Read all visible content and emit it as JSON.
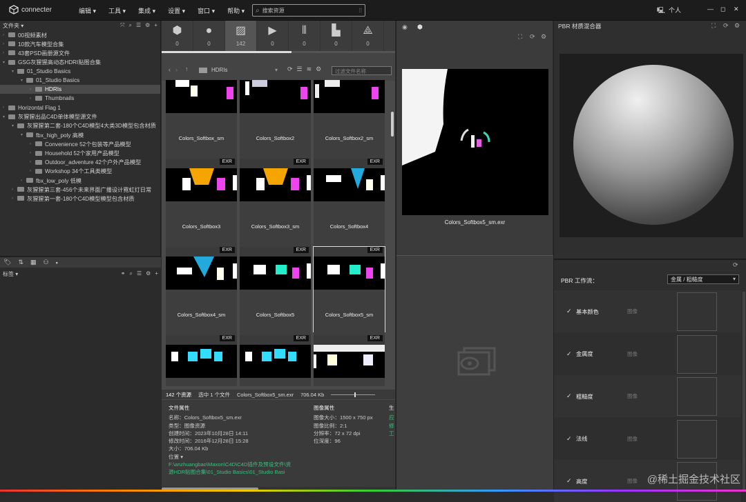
{
  "app": {
    "name": "connecter"
  },
  "menu": [
    "编辑 ▾",
    "工具 ▾",
    "集成 ▾",
    "设置 ▾",
    "窗口 ▾",
    "帮助 ▾"
  ],
  "search": {
    "placeholder": "搜索资源"
  },
  "user": {
    "label": "个人"
  },
  "left": {
    "header": "文件夹 ▾",
    "tree": [
      {
        "indent": 0,
        "label": "00视频素材",
        "arrow": ""
      },
      {
        "indent": 0,
        "label": "10款汽车模型合集",
        "arrow": ""
      },
      {
        "indent": 0,
        "label": "43套PSD画册源文件",
        "arrow": ""
      },
      {
        "indent": 0,
        "label": "GSG灰猩猩高动态HDRI贴图合集",
        "arrow": "▾"
      },
      {
        "indent": 1,
        "label": "01_Studio Basics",
        "arrow": "▾"
      },
      {
        "indent": 2,
        "label": "01_Studio Basics",
        "arrow": "▾"
      },
      {
        "indent": 3,
        "label": "HDRIs",
        "arrow": "",
        "sel": true
      },
      {
        "indent": 3,
        "label": "Thumbnails",
        "arrow": ""
      },
      {
        "indent": 0,
        "label": "Horizontal Flag 1",
        "arrow": ""
      },
      {
        "indent": 0,
        "label": "灰猩猩出品C4D单体模型源文件",
        "arrow": "▾"
      },
      {
        "indent": 1,
        "label": "灰猩猩第二套-180个C4D模型4大类3D模型包含材质",
        "arrow": "▾"
      },
      {
        "indent": 2,
        "label": "fbx_high_poly 高模",
        "arrow": "▾"
      },
      {
        "indent": 3,
        "label": "Convenience 52个包装等产品模型",
        "arrow": ""
      },
      {
        "indent": 3,
        "label": "Household 52个家用产品模型",
        "arrow": ""
      },
      {
        "indent": 3,
        "label": "Outdoor_adventure 42个户外产品模型",
        "arrow": ""
      },
      {
        "indent": 3,
        "label": "Workshop 34个工具类模型",
        "arrow": ""
      },
      {
        "indent": 2,
        "label": "fbx_low_poly 低模",
        "arrow": ""
      },
      {
        "indent": 1,
        "label": "灰猩猩第三套-456个未来界面广播设计霓虹灯日常",
        "arrow": ""
      },
      {
        "indent": 1,
        "label": "灰猩猩第一套-180个C4D模型模型包含材质",
        "arrow": ""
      }
    ],
    "tags_header": "标签 ▾"
  },
  "types": [
    {
      "icon": "⬢",
      "count": "0"
    },
    {
      "icon": "●",
      "count": "0"
    },
    {
      "icon": "▨",
      "count": "142"
    },
    {
      "icon": "▶",
      "count": "0"
    },
    {
      "icon": "⫴",
      "count": "0"
    },
    {
      "icon": "▙",
      "count": "0"
    },
    {
      "icon": "⟁",
      "count": "0"
    }
  ],
  "nav": {
    "path": "HDRIs",
    "filter_placeholder": "过滤文件名称"
  },
  "cards": [
    {
      "name": "Colors_Softbox_sm",
      "exr": ""
    },
    {
      "name": "Colors_Softbox2",
      "exr": ""
    },
    {
      "name": "Colors_Softbox2_sm",
      "exr": ""
    },
    {
      "name": "Colors_Softbox3",
      "exr": "EXR"
    },
    {
      "name": "Colors_Softbox3_sm",
      "exr": "EXR"
    },
    {
      "name": "Colors_Softbox4",
      "exr": "EXR"
    },
    {
      "name": "Colors_Softbox4_sm",
      "exr": "EXR"
    },
    {
      "name": "Colors_Softbox5",
      "exr": "EXR"
    },
    {
      "name": "Colors_Softbox5_sm",
      "exr": "EXR"
    },
    {
      "name": "",
      "exr": "EXR"
    },
    {
      "name": "",
      "exr": "EXR"
    },
    {
      "name": "",
      "exr": "EXR"
    }
  ],
  "status": {
    "count": "142 个资源",
    "selected": "选中 1 个文件",
    "file": "Colors_Softbox5_sm.exr",
    "size": "706.04 Kb"
  },
  "props": {
    "file_title": "文件属性",
    "file": [
      "名称：Colors_Softbox5_sm.exr",
      "类型：图像资源",
      "创建时间：2023年10月28日 14:11",
      "修改时间：2016年12月28日 15:28",
      "大小：706.04 Kb",
      "位置 ▾"
    ],
    "path": [
      "F:\\anzhuangbao\\Maxon\\C4D\\C4D插件及预设文件\\资",
      "源HDR贴图合集\\01_Studio Basics\\01_Studio Basi"
    ],
    "img_title": "图像属性",
    "img": [
      "图像大小：1500 x 750 px",
      "图像比例：2:1",
      "分辨率：72 x 72 dpi",
      "位深度：96"
    ],
    "gen_title": "生",
    "gen": [
      "应",
      "修",
      "工"
    ]
  },
  "preview": {
    "filename": "Colors_Softbox5_sm.exr"
  },
  "right": {
    "title": "PBR 材质混合器",
    "workflow_label": "PBR 工作流：",
    "workflow_value": "金属 / 粗糙度",
    "rows": [
      {
        "label": "基本颜色",
        "sub": "图像"
      },
      {
        "label": "金属度",
        "sub": "图像"
      },
      {
        "label": "粗糙度",
        "sub": "图像"
      },
      {
        "label": "法线",
        "sub": "图像"
      },
      {
        "label": "高度",
        "sub": "图像"
      }
    ]
  },
  "watermark": "@稀土掘金技术社区"
}
